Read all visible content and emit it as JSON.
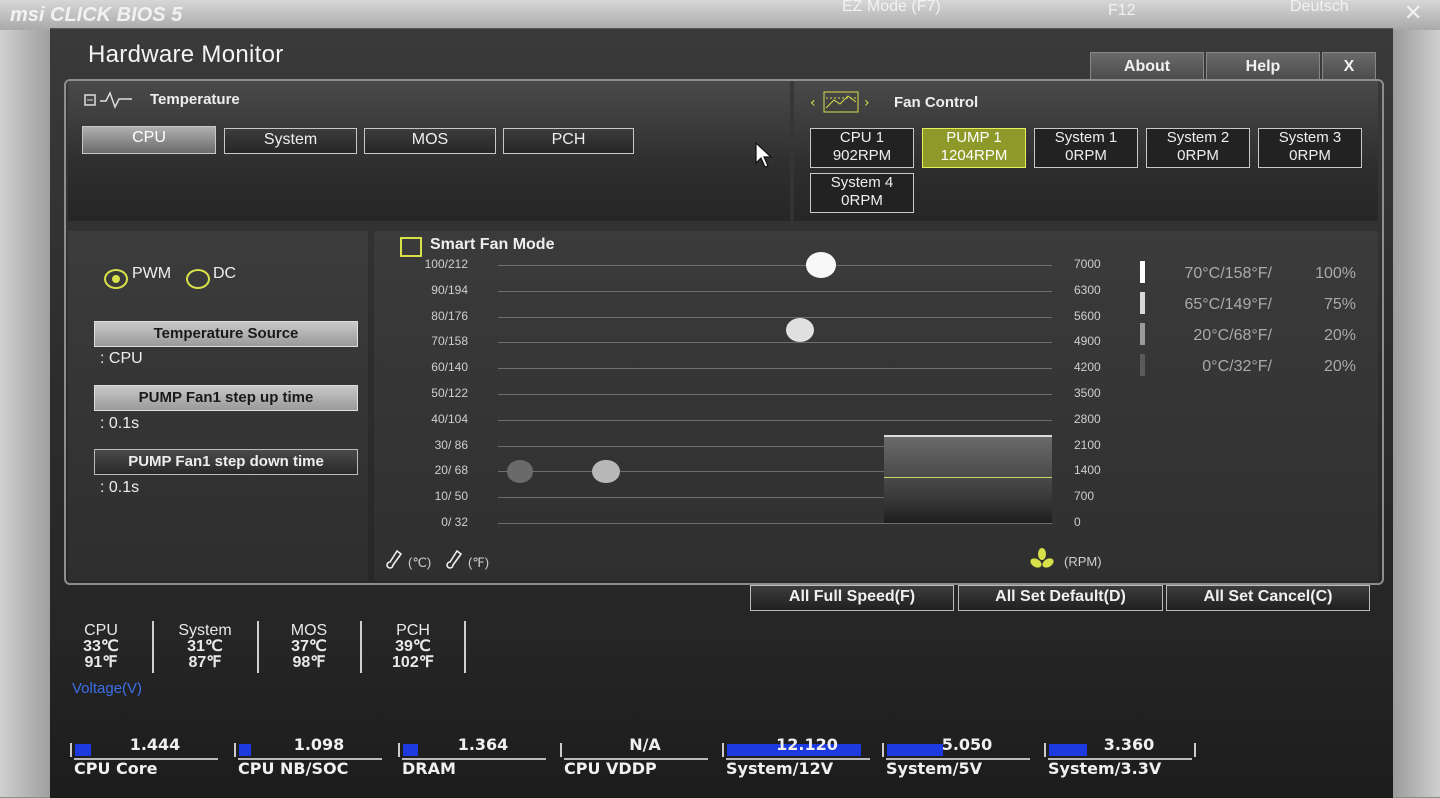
{
  "background": {
    "brand": "msi CLICK BIOS 5",
    "ez_mode": "EZ Mode (F7)",
    "f12": "F12",
    "language": "Deutsch"
  },
  "window": {
    "title": "Hardware Monitor",
    "about": "About",
    "help": "Help",
    "close": "X"
  },
  "temperature": {
    "heading": "Temperature",
    "tabs": [
      "CPU",
      "System",
      "MOS",
      "PCH"
    ]
  },
  "fan_control": {
    "heading": "Fan Control",
    "fans": [
      {
        "name": "CPU 1",
        "rpm": "902RPM"
      },
      {
        "name": "PUMP 1",
        "rpm": "1204RPM"
      },
      {
        "name": "System 1",
        "rpm": "0RPM"
      },
      {
        "name": "System 2",
        "rpm": "0RPM"
      },
      {
        "name": "System 3",
        "rpm": "0RPM"
      },
      {
        "name": "System 4",
        "rpm": "0RPM"
      }
    ],
    "selected": "PUMP 1"
  },
  "mode": {
    "pwm": "PWM",
    "dc": "DC",
    "selected": "PWM",
    "temp_source_label": "Temperature Source",
    "temp_source_value": ": CPU",
    "step_up_label": "PUMP Fan1 step up time",
    "step_up_value": ": 0.1s",
    "step_down_label": "PUMP Fan1 step down time",
    "step_down_value": ": 0.1s"
  },
  "chart_data": {
    "type": "scatter",
    "title": "Smart Fan Mode",
    "y_left_ticks": [
      "100/212",
      "90/194",
      "80/176",
      "70/158",
      "60/140",
      "50/122",
      "40/104",
      "30/ 86",
      "20/ 68",
      "10/ 50",
      "0/ 32"
    ],
    "y_right_ticks": [
      "7000",
      "6300",
      "5600",
      "4900",
      "4200",
      "3500",
      "2800",
      "2100",
      "1400",
      "700",
      "0"
    ],
    "xlabel_left": "(℃)",
    "xlabel_left2": "(℉)",
    "xlabel_right": "(RPM)",
    "ylim_percent": [
      0,
      100
    ],
    "points": [
      {
        "temp_c": 0,
        "percent": 20
      },
      {
        "temp_c": 20,
        "percent": 20
      },
      {
        "temp_c": 65,
        "percent": 75
      },
      {
        "temp_c": 70,
        "percent": 100
      }
    ],
    "table": [
      {
        "temp": "70°C/158°F/",
        "percent": "100%"
      },
      {
        "temp": "65°C/149°F/",
        "percent": "75%"
      },
      {
        "temp": "20°C/68°F/",
        "percent": "20%"
      },
      {
        "temp": "0°C/32°F/",
        "percent": "20%"
      }
    ]
  },
  "actions": {
    "full_speed": "All Full Speed(F)",
    "set_default": "All Set Default(D)",
    "set_cancel": "All Set Cancel(C)"
  },
  "readings": [
    {
      "name": "CPU",
      "c": "33℃",
      "f": "91℉"
    },
    {
      "name": "System",
      "c": "31℃",
      "f": "87℉"
    },
    {
      "name": "MOS",
      "c": "37℃",
      "f": "98℉"
    },
    {
      "name": "PCH",
      "c": "39℃",
      "f": "102℉"
    }
  ],
  "voltage": {
    "heading": "Voltage(V)",
    "items": [
      {
        "name": "CPU Core",
        "value": "1.444",
        "level": 0.12
      },
      {
        "name": "CPU NB/SOC",
        "value": "1.098",
        "level": 0.09
      },
      {
        "name": "DRAM",
        "value": "1.364",
        "level": 0.11
      },
      {
        "name": "CPU VDDP",
        "value": "N/A",
        "level": 0
      },
      {
        "name": "System/12V",
        "value": "12.120",
        "level": 1.0
      },
      {
        "name": "System/5V",
        "value": "5.050",
        "level": 0.42
      },
      {
        "name": "System/3.3V",
        "value": "3.360",
        "level": 0.28
      }
    ]
  },
  "colors": {
    "accent_yellow": "#d8e04a",
    "voltage_bar": "#1d3ae0"
  }
}
